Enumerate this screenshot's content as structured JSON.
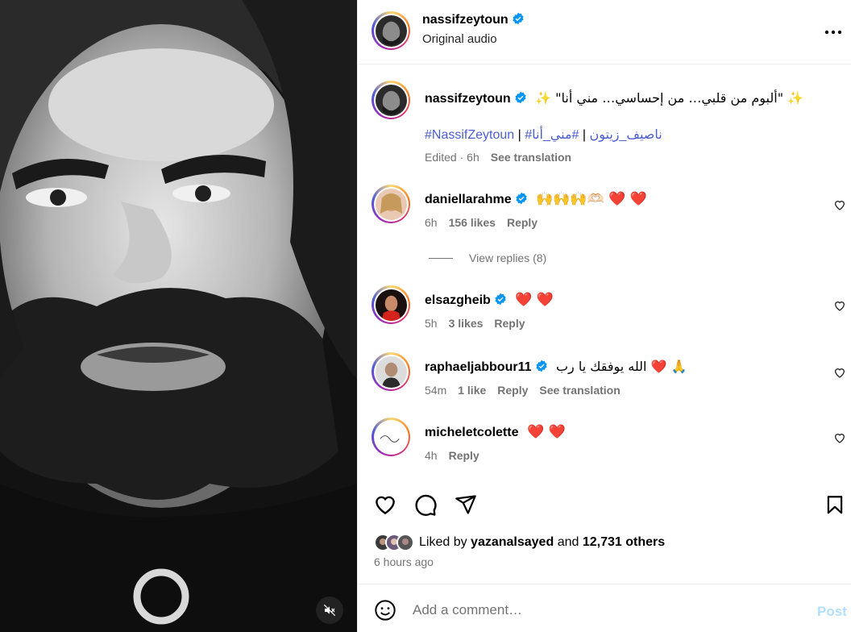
{
  "header": {
    "username": "nassifzeytoun",
    "subtitle": "Original audio"
  },
  "caption": {
    "username": "nassifzeytoun",
    "text": "✨ \"ألبوم من قلبي… من إحساسي… مني أنا\" ✨",
    "hashtags": [
      "#NassifZeytoun",
      "#ناصيف_زيتون",
      "#مني_أنا"
    ],
    "separator": " | ",
    "edited": "Edited",
    "time": "6h",
    "see_translation": "See translation"
  },
  "comments": [
    {
      "username": "daniellarahme",
      "text": "🙌🙌🙌🫶🏻 ❤️ ❤️",
      "time": "6h",
      "likes": "156 likes",
      "reply": "Reply",
      "view_replies": "View replies (8)"
    },
    {
      "username": "elsazgheib",
      "text": "❤️ ❤️",
      "time": "5h",
      "likes": "3 likes",
      "reply": "Reply"
    },
    {
      "username": "raphaeljabbour11",
      "text": "الله يوفقك يا رب ❤️ 🙏",
      "time": "54m",
      "likes": "1 like",
      "reply": "Reply",
      "see_translation": "See translation"
    },
    {
      "username": "micheletcolette",
      "text": "❤️ ❤️",
      "time": "4h",
      "reply": "Reply"
    }
  ],
  "liked_by": {
    "prefix": "Liked by",
    "user": "yazanalsayed",
    "and": "and",
    "others": "12,731 others"
  },
  "time_ago": "6 hours ago",
  "comment_input": {
    "placeholder": "Add a comment…",
    "post_label": "Post"
  },
  "colors": {
    "verified": "#0095f6",
    "hashtag": "#4a5dd1",
    "post_disabled": "#b2dffc",
    "heart": "#e0112b"
  },
  "icons": {
    "more": "more-horizontal-icon",
    "like": "heart-outline-icon",
    "comment": "comment-bubble-icon",
    "share": "paper-plane-icon",
    "save": "bookmark-icon",
    "emoji": "smiley-icon",
    "mute": "speaker-muted-icon"
  }
}
